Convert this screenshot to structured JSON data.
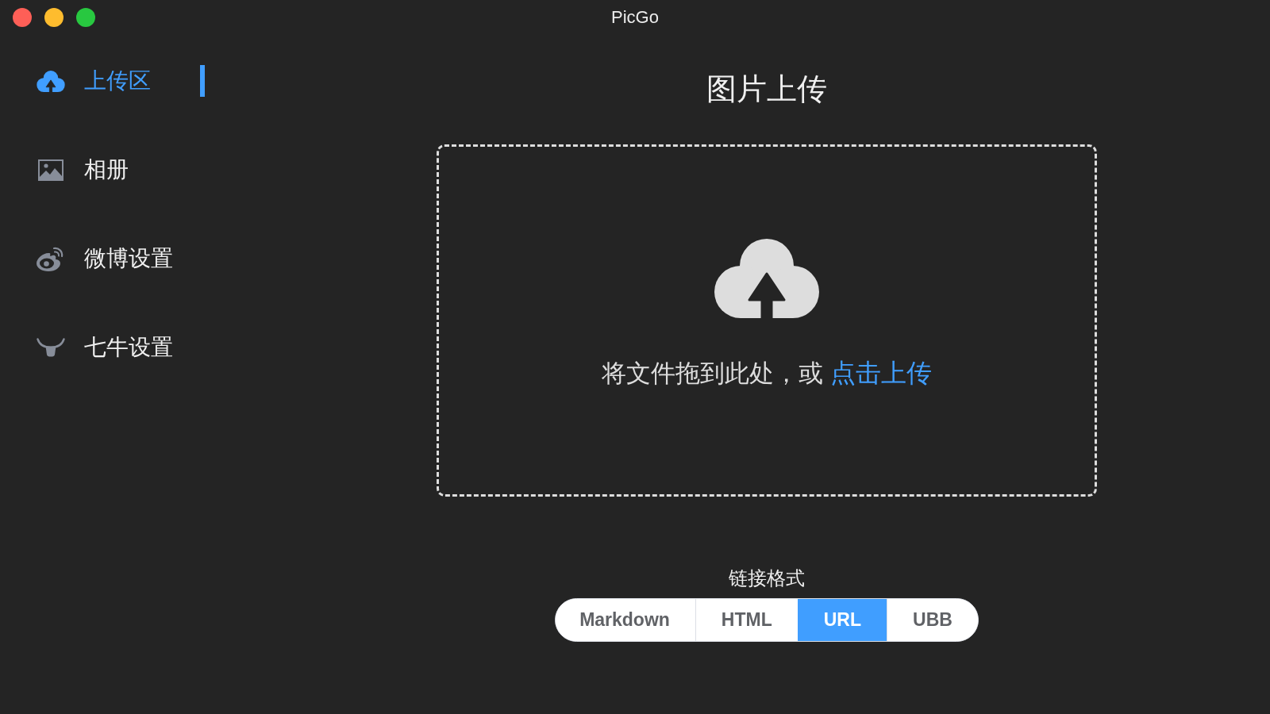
{
  "window": {
    "title": "PicGo"
  },
  "sidebar": {
    "items": [
      {
        "label": "上传区",
        "selected": true
      },
      {
        "label": "相册",
        "selected": false
      },
      {
        "label": "微博设置",
        "selected": false
      },
      {
        "label": "七牛设置",
        "selected": false
      }
    ]
  },
  "upload": {
    "title": "图片上传",
    "hint": "将文件拖到此处，或",
    "link": "点击上传"
  },
  "link_format": {
    "label": "链接格式",
    "options": [
      {
        "label": "Markdown",
        "selected": false
      },
      {
        "label": "HTML",
        "selected": false
      },
      {
        "label": "URL",
        "selected": true
      },
      {
        "label": "UBB",
        "selected": false
      }
    ]
  }
}
